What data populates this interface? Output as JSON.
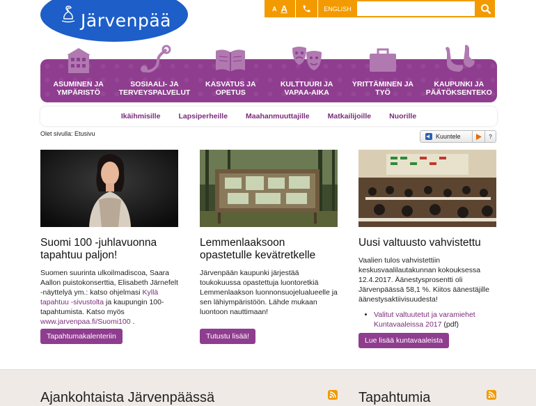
{
  "logo": {
    "text": "Järvenpää"
  },
  "topbar": {
    "font_small": "A",
    "font_large": "A",
    "lang": "ENGLISH",
    "search_placeholder": ""
  },
  "main_nav": [
    {
      "line1": "Asuminen ja",
      "line2": "ympäristö",
      "icon": "house-icon"
    },
    {
      "line1": "Sosiaali- ja",
      "line2": "terveyspalvelut",
      "icon": "stethoscope-icon"
    },
    {
      "line1": "Kasvatus ja",
      "line2": "opetus",
      "icon": "book-icon"
    },
    {
      "line1": "Kulttuuri ja",
      "line2": "vapaa-aika",
      "icon": "theater-masks-icon"
    },
    {
      "line1": "Yrittäminen ja",
      "line2": "työ",
      "icon": "briefcase-icon"
    },
    {
      "line1": "Kaupunki ja",
      "line2": "päätöksenteko",
      "icon": "swans-icon"
    }
  ],
  "sub_nav": [
    "Ikäihmisille",
    "Lapsiperheille",
    "Maahanmuuttajille",
    "Matkailijoille",
    "Nuorille"
  ],
  "breadcrumb": "Olet sivulla: Etusivu",
  "readspeaker": {
    "label": "Kuuntele",
    "help": "?"
  },
  "columns": [
    {
      "title": "Suomi 100 -juhlavuonna tapahtuu paljon!",
      "text_before": "Suomen suurinta ulkoilmadiscoa, Saara Aallon puistokonserttia, Elisabeth Järnefelt -näyttelyä ym.: katso ohjelmasi ",
      "link1": "Kyllä tapahtuu -sivustolta",
      "text_mid": " ja kaupungin 100-tapahtumista. Katso myös ",
      "link2": "www.jarvenpaa.fi/Suomi100",
      "text_after": " .",
      "button": "Tapahtumakalenteriin"
    },
    {
      "title": "Lemmenlaaksoon opastetulle kevätretkelle",
      "text": "Järvenpään kaupunki järjestää toukokuussa opastettuja luontoretkiä Lemmenlaakson luonnonsuojelualueelle ja sen lähiympäristöön. Lähde mukaan luontoon nauttimaan!",
      "button": "Tutustu lisää!"
    },
    {
      "title": "Uusi valtuusto vahvistettu",
      "text": "Vaalien tulos vahvistettiin keskusvaalilautakunnan kokouksessa 12.4.2017. Äänestysprosentti oli Järvenpäässä 58,1 %. Kiitos äänestäjille äänestysaktiivisuudesta!",
      "list_link": "Valitut valtuutetut ja varamiehet Kuntavaaleissa 2017",
      "list_suffix": " (pdf)",
      "button": "Lue lisää kuntavaaleista"
    }
  ],
  "bottom": {
    "left_heading": "Ajankohtaista Järvenpäässä",
    "right_heading": "Tapahtumia"
  },
  "colors": {
    "purple": "#8f3d8f",
    "orange": "#f29a00",
    "blue": "#1d5ec8",
    "link": "#7a2c7a"
  }
}
